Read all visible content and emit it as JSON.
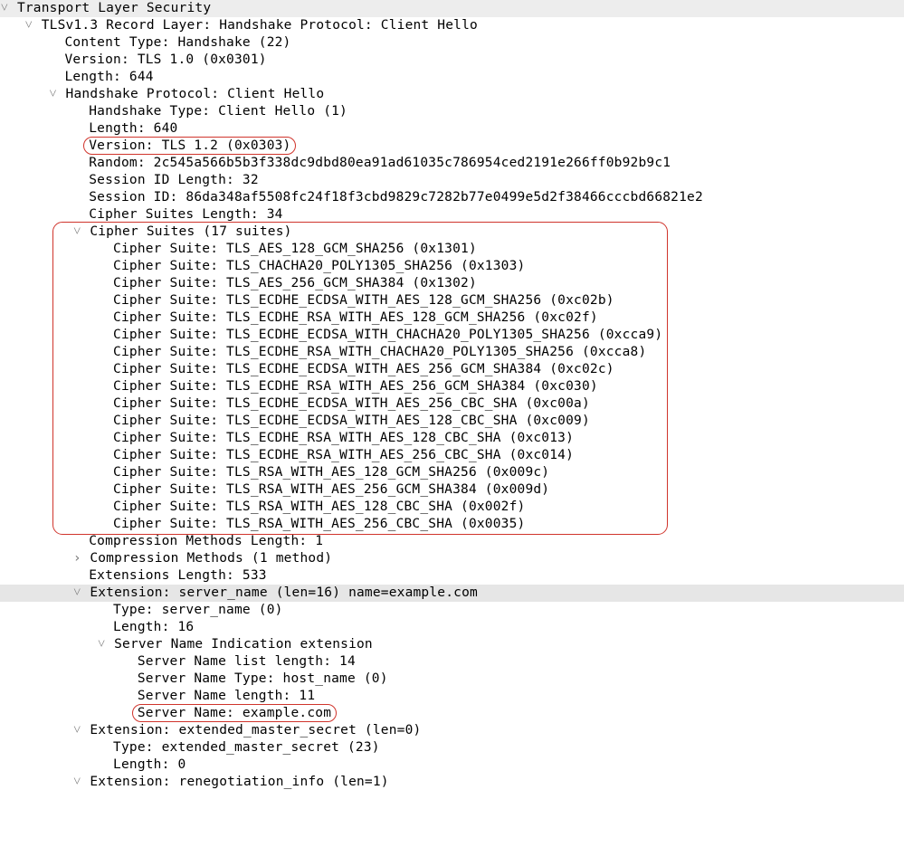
{
  "root_label": "Transport Layer Security",
  "record_label": "TLSv1.3 Record Layer: Handshake Protocol: Client Hello",
  "record": {
    "content_type": "Content Type: Handshake (22)",
    "version": "Version: TLS 1.0 (0x0301)",
    "length": "Length: 644"
  },
  "hs_label": "Handshake Protocol: Client Hello",
  "hs": {
    "type": "Handshake Type: Client Hello (1)",
    "length": "Length: 640",
    "version": "Version: TLS 1.2 (0x0303)",
    "random": "Random: 2c545a566b5b3f338dc9dbd80ea91ad61035c786954ced2191e266ff0b92b9c1",
    "sid_len": "Session ID Length: 32",
    "sid": "Session ID: 86da348af5508fc24f18f3cbd9829c7282b77e0499e5d2f38466cccbd66821e2",
    "cs_len": "Cipher Suites Length: 34"
  },
  "cs_label": "Cipher Suites (17 suites)",
  "cipher_suites": [
    "Cipher Suite: TLS_AES_128_GCM_SHA256 (0x1301)",
    "Cipher Suite: TLS_CHACHA20_POLY1305_SHA256 (0x1303)",
    "Cipher Suite: TLS_AES_256_GCM_SHA384 (0x1302)",
    "Cipher Suite: TLS_ECDHE_ECDSA_WITH_AES_128_GCM_SHA256 (0xc02b)",
    "Cipher Suite: TLS_ECDHE_RSA_WITH_AES_128_GCM_SHA256 (0xc02f)",
    "Cipher Suite: TLS_ECDHE_ECDSA_WITH_CHACHA20_POLY1305_SHA256 (0xcca9)",
    "Cipher Suite: TLS_ECDHE_RSA_WITH_CHACHA20_POLY1305_SHA256 (0xcca8)",
    "Cipher Suite: TLS_ECDHE_ECDSA_WITH_AES_256_GCM_SHA384 (0xc02c)",
    "Cipher Suite: TLS_ECDHE_RSA_WITH_AES_256_GCM_SHA384 (0xc030)",
    "Cipher Suite: TLS_ECDHE_ECDSA_WITH_AES_256_CBC_SHA (0xc00a)",
    "Cipher Suite: TLS_ECDHE_ECDSA_WITH_AES_128_CBC_SHA (0xc009)",
    "Cipher Suite: TLS_ECDHE_RSA_WITH_AES_128_CBC_SHA (0xc013)",
    "Cipher Suite: TLS_ECDHE_RSA_WITH_AES_256_CBC_SHA (0xc014)",
    "Cipher Suite: TLS_RSA_WITH_AES_128_GCM_SHA256 (0x009c)",
    "Cipher Suite: TLS_RSA_WITH_AES_256_GCM_SHA384 (0x009d)",
    "Cipher Suite: TLS_RSA_WITH_AES_128_CBC_SHA (0x002f)",
    "Cipher Suite: TLS_RSA_WITH_AES_256_CBC_SHA (0x0035)"
  ],
  "cm_len": "Compression Methods Length: 1",
  "cm_label": "Compression Methods (1 method)",
  "ext_len": "Extensions Length: 533",
  "ext_sn_label": "Extension: server_name (len=16) name=example.com",
  "ext_sn": {
    "type": "Type: server_name (0)",
    "length": "Length: 16"
  },
  "sni_label": "Server Name Indication extension",
  "sni": {
    "list_len": "Server Name list length: 14",
    "name_type": "Server Name Type: host_name (0)",
    "name_len": "Server Name length: 11",
    "name": "Server Name: example.com"
  },
  "ext_ems_label": "Extension: extended_master_secret (len=0)",
  "ext_ems": {
    "type": "Type: extended_master_secret (23)",
    "length": "Length: 0"
  },
  "ext_ri_label": "Extension: renegotiation_info (len=1)"
}
